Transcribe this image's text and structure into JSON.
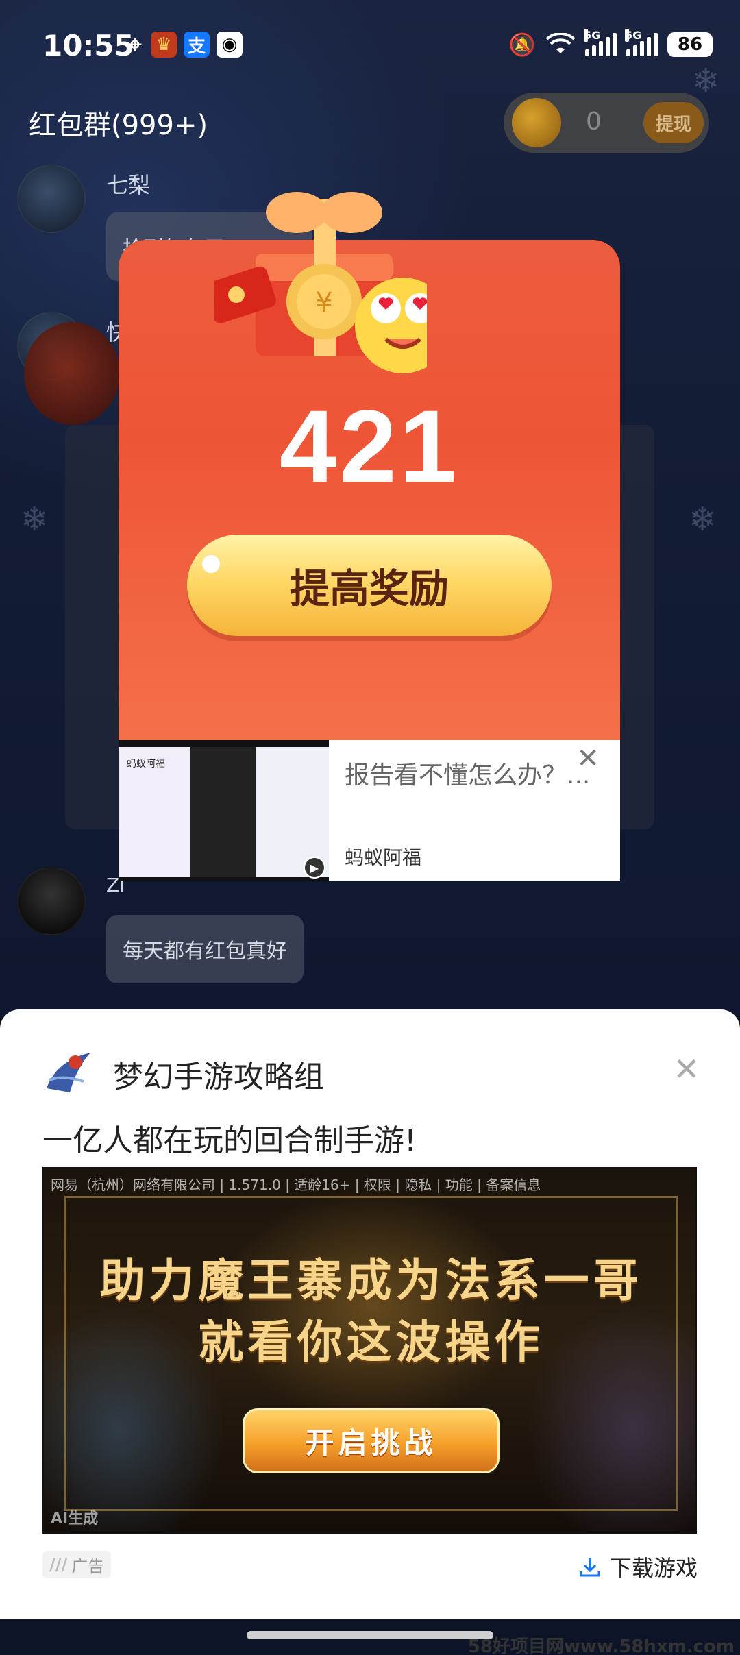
{
  "status_bar": {
    "time": "10:55",
    "net1": "5G",
    "net2": "5G",
    "battery": "86"
  },
  "chat": {
    "title": "红包群(999+)",
    "coin_count": "0",
    "withdraw_label": "提现",
    "messages": [
      {
        "sender": "七梨",
        "text": "抢到红包了"
      },
      {
        "sender": "快",
        "text": ""
      },
      {
        "sender": "Zi",
        "text": "每天都有红包真好"
      }
    ]
  },
  "reward_modal": {
    "amount": "421",
    "boost_button": "提高奖励"
  },
  "inline_ad": {
    "title": "报告看不懂怎么办？...",
    "brand": "蚂蚁阿福",
    "thumb_caption": "蚂蚁阿福"
  },
  "bottom_ad": {
    "app_name": "梦幻手游攻略组",
    "description": "一亿人都在玩的回合制手游!",
    "legal": "网易（杭州）网络有限公司 | 1.571.0 | 适龄16+ | 权限 | 隐私 | 功能 | 备案信息",
    "headline1": "助力魔王寨成为法系一哥",
    "headline2": "就看你这波操作",
    "challenge_button": "开启挑战",
    "corner_mark": "AI生成",
    "ad_label": "广告",
    "download_label": "下载游戏"
  },
  "watermark": "58好项目网www.58hxm.com",
  "colors": {
    "modal_red": "#ee5536",
    "button_gold": "#ffd867",
    "sheet_bg": "#ffffff"
  }
}
